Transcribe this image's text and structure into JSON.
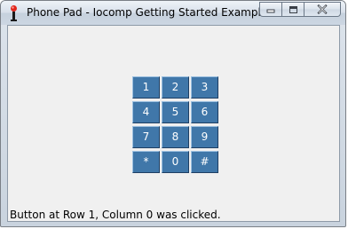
{
  "window": {
    "title": "Phone Pad - Iocomp Getting Started Example"
  },
  "caption_buttons": {
    "minimize_icon": "minimize-icon",
    "maximize_icon": "maximize-icon",
    "close_icon": "close-icon"
  },
  "keypad": {
    "keys": [
      [
        "1",
        "2",
        "3"
      ],
      [
        "4",
        "5",
        "6"
      ],
      [
        "7",
        "8",
        "9"
      ],
      [
        "*",
        "0",
        "#"
      ]
    ],
    "colors": {
      "face": "#4077a9",
      "highlight": "#9cc0e0",
      "shadow": "#1f3f63",
      "text": "#ffffff"
    }
  },
  "status": {
    "text": "Button at Row 1, Column 0 was clicked."
  }
}
